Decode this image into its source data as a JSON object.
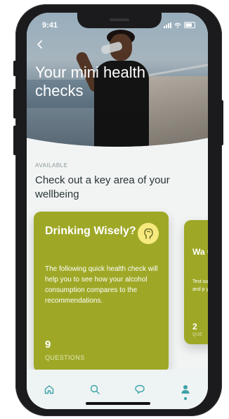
{
  "status_bar": {
    "time": "9:41"
  },
  "hero": {
    "title": "Your mini health checks"
  },
  "section": {
    "eyebrow": "AVAILABLE",
    "subtitle": "Check out a key area of your wellbeing"
  },
  "cards": [
    {
      "title": "Drinking Wisely?",
      "description": "The following quick health check will help you to see how your alcohol consumption compares to the recommendations.",
      "questions_count": "9",
      "questions_label": "QUESTIONS",
      "icon": "head-icon"
    },
    {
      "title": "Wa Che",
      "description": "Test our T We'll and p you",
      "questions_count": "2",
      "questions_label": "QUE"
    }
  ],
  "tabbar": {
    "items": [
      {
        "name": "home",
        "icon": "home-icon"
      },
      {
        "name": "search",
        "icon": "search-icon"
      },
      {
        "name": "chat",
        "icon": "chat-icon"
      },
      {
        "name": "profile",
        "icon": "profile-icon",
        "active": true
      }
    ]
  },
  "colors": {
    "card": "#9ea826",
    "badge": "#f6e97e",
    "accent": "#3ba3a8",
    "background": "#f2f4f4"
  }
}
